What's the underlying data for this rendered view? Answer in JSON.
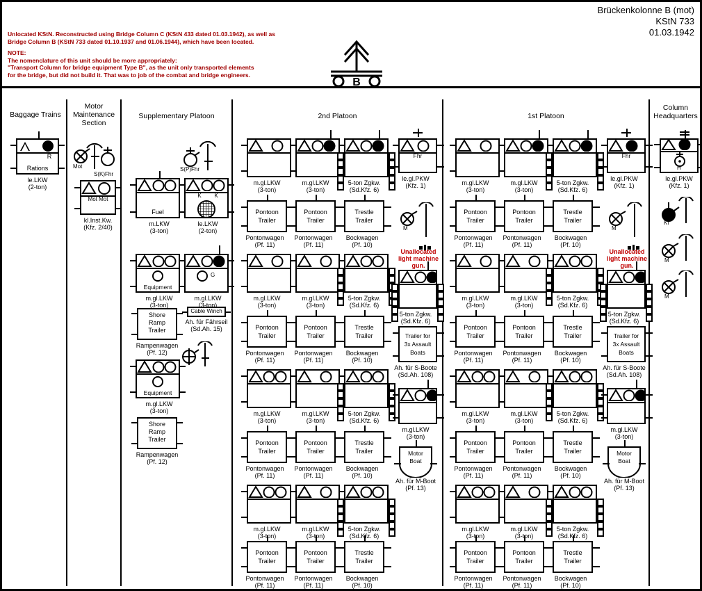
{
  "title": {
    "unit_name": "Brückenkolonne B (mot)",
    "kstn": "KStN 733",
    "date": "01.03.1942"
  },
  "note": {
    "line1": "Unlocated KStN. Reconstructed using Bridge Column C (KStN 433 dated 01.03.1942), as well as",
    "line2": "Bridge Column B (KStN 733 dated 01.10.1937 and 01.06.1944), which have been located.",
    "heading": "NOTE:",
    "line3": "The nomenclature of this unit should be more appropriately:",
    "line4": "\"Transport Column for bridge equipment Type B\", as the unit only transported elements",
    "line5": "for the bridge,  but did not build it. That was to job of the combat and bridge engineers."
  },
  "unit_symbol": {
    "letter": "B",
    "icon": "bridging-column-icon"
  },
  "columns": {
    "baggage": {
      "heading": "Baggage Trains"
    },
    "motor": {
      "heading_l1": "Motor",
      "heading_l2": "Maintenance",
      "heading_l3": "Section"
    },
    "supplementary": {
      "heading": "Supplementary Platoon"
    },
    "platoon2": {
      "heading": "2nd Platoon"
    },
    "platoon1": {
      "heading": "1st Platoon"
    },
    "hq": {
      "heading_l1": "Column",
      "heading_l2": "Headquarters"
    }
  },
  "labels": {
    "rations": "Rations",
    "r": "R",
    "le_lkw": "le.LKW",
    "two_ton": "(2-ton)",
    "m_lkw": "m.LKW",
    "three_ton": "(3-ton)",
    "mgl_lkw": "m.gl.LKW",
    "le_gl_pkw": "le.gl.PKW",
    "kfz1": "(Kfz. 1)",
    "mot": "Mot",
    "mot_mot": "Mot Mot",
    "skfhr": "S(K)Fhr",
    "spfhr": "S(P)Fhr",
    "fhr": "Fhr",
    "kl_inst_kw": "kl.Inst.Kw.",
    "kfz240": "(Kfz. 2/40)",
    "fuel": "Fuel",
    "equipment": "Equipment",
    "k": "K",
    "g": "G",
    "h": "H",
    "m": "M",
    "kf": "Kf",
    "cable_winch": "Cable Winch",
    "ah_faehrseil": "Ah. für Fährseil",
    "sdah15": "(Sd.Ah. 15)",
    "shore_ramp_l1": "Shore",
    "shore_ramp_l2": "Ramp",
    "shore_ramp_l3": "Trailer",
    "rampenwagen": "Rampenwagen",
    "pf12": "(Pf. 12)",
    "pontoon_l1": "Pontoon",
    "pontoon_l2": "Trailer",
    "pontonwagen": "Pontonwagen",
    "pf11": "(Pf. 11)",
    "trestle_l1": "Trestle",
    "trestle_l2": "Trailer",
    "bockwagen": "Bockwagen",
    "pf10": "(Pf. 10)",
    "zgkw5": "5-ton Zgkw.",
    "sdkfz6": "(Sd.Kfz. 6)",
    "assault_l1": "Trailer for",
    "assault_l2": "3x Assault",
    "assault_l3": "Boats",
    "ah_sboote": "Ah. für S-Boote",
    "sdah108": "(Sd.Ah. 108)",
    "motor_boat_l1": "Motor",
    "motor_boat_l2": "Boat",
    "ah_mboot": "Ah. für M-Boot",
    "pf13": "(Pf. 13)",
    "unalloc_l1": "Unallocated",
    "unalloc_l2": "light machine",
    "unalloc_l3": "gun."
  },
  "colors": {
    "ink": "#000000",
    "note_red": "#a00000",
    "caption_red": "#c00000"
  }
}
